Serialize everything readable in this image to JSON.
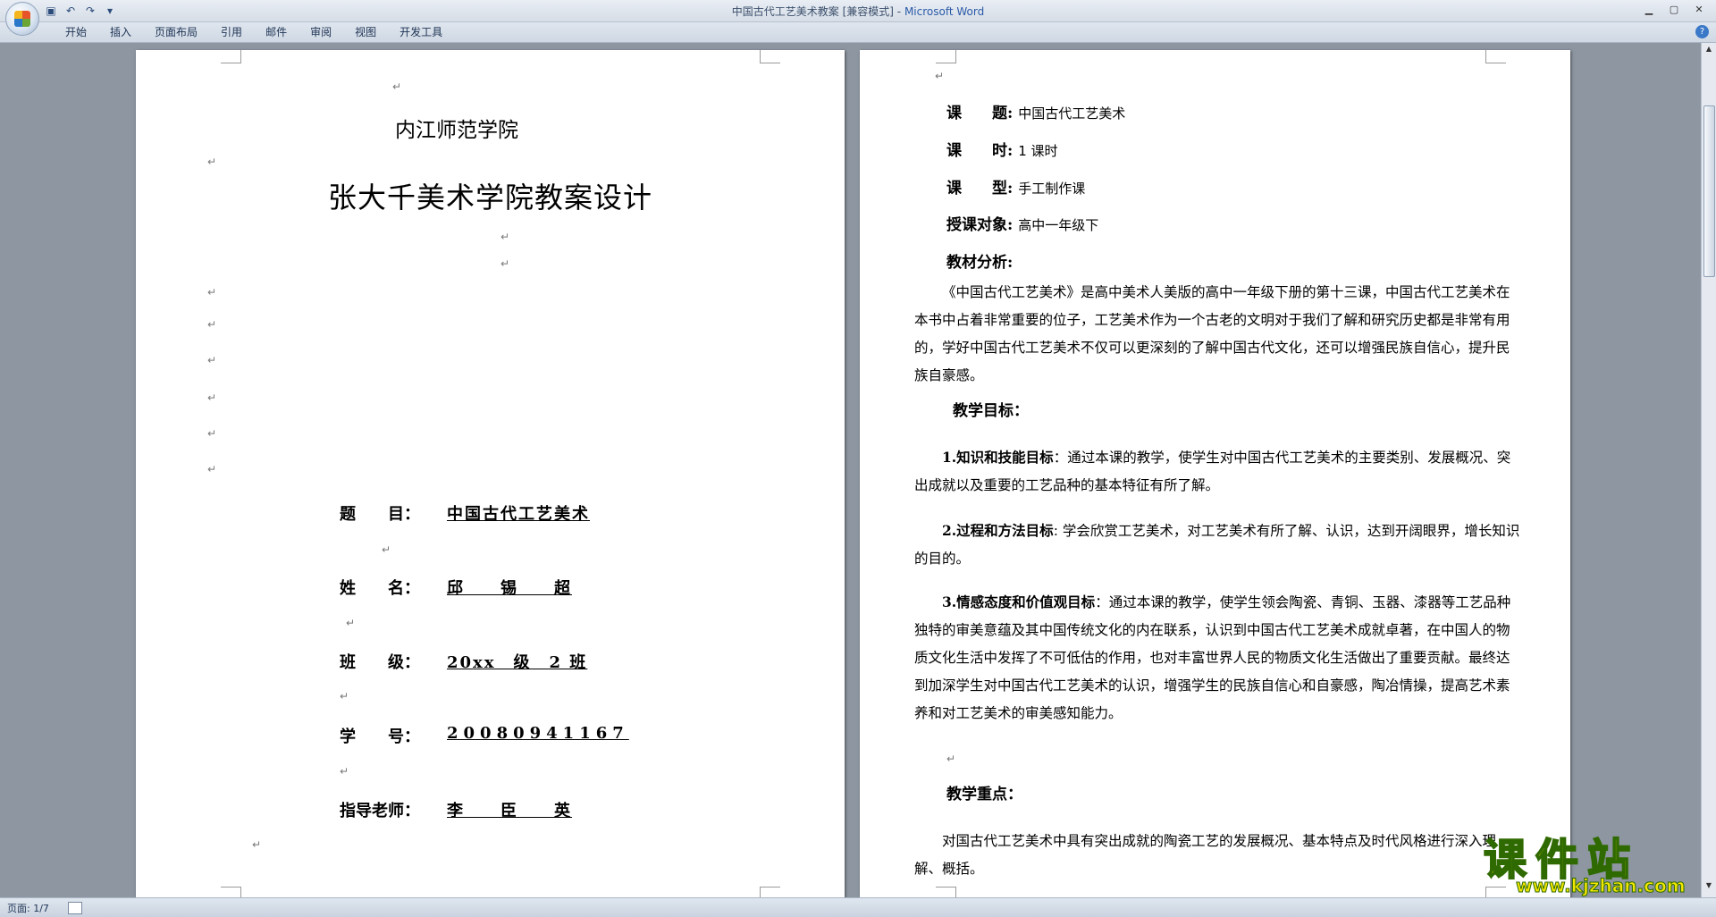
{
  "window": {
    "title": "中国古代工艺美术教案 [兼容模式]",
    "separator": " - ",
    "app": "Microsoft Word"
  },
  "qat": {
    "save": "▣",
    "undo": "↶",
    "redo": "↷",
    "more": "▾"
  },
  "ribbon": {
    "tabs": [
      "开始",
      "插入",
      "页面布局",
      "引用",
      "邮件",
      "审阅",
      "视图",
      "开发工具"
    ],
    "help": "?"
  },
  "page1": {
    "school": "内江师范学院",
    "title": "张大千美术学院教案设计",
    "fields": [
      {
        "label": "题　　目：",
        "value": "中国古代工艺美术"
      },
      {
        "label": "姓　　名：",
        "value": "邱　　锡　　超"
      },
      {
        "label": "班　　级：",
        "value": "20xx　级　2 班"
      },
      {
        "label": "学　　号：",
        "value": "20080941167"
      },
      {
        "label": "指导老师：",
        "value": "李　　臣　　英"
      }
    ]
  },
  "page2": {
    "course_title_label": "课　　题:",
    "course_title": "中国古代工艺美术",
    "hours_label": "课　　时:",
    "hours": "1 课时",
    "type_label": "课　　型:",
    "type": "手工制作课",
    "audience_label": "授课对象:",
    "audience": "高中一年级下",
    "analysis_label": "教材分析:",
    "analysis_text": "《中国古代工艺美术》是高中美术人美版的高中一年级下册的第十三课，中国古代工艺美术在本书中占着非常重要的位子，工艺美术作为一个古老的文明对于我们了解和研究历史都是非常有用的，学好中国古代工艺美术不仅可以更深刻的了解中国古代文化，还可以增强民族自信心，提升民族自豪感。",
    "goals_label": "教学目标：",
    "goal1_label": "1.知识和技能目标",
    "goal1_text": "：通过本课的教学，使学生对中国古代工艺美术的主要类别、发展概况、突出成就以及重要的工艺品种的基本特征有所了解。",
    "goal2_label": "2.过程和方法目标",
    "goal2_text": ": 学会欣赏工艺美术，对工艺美术有所了解、认识，达到开阔眼界，增长知识的目的。",
    "goal3_label": "3.情感态度和价值观目标",
    "goal3_text": "：通过本课的教学，使学生领会陶瓷、青铜、玉器、漆器等工艺品种独特的审美意蕴及其中国传统文化的内在联系，认识到中国古代工艺美术成就卓著，在中国人的物质文化生活中发挥了不可低估的作用，也对丰富世界人民的物质文化生活做出了重要贡献。最终达到加深学生对中国古代工艺美术的认识，增强学生的民族自信心和自豪感，陶冶情操，提高艺术素养和对工艺美术的审美感知能力。",
    "focus_label": "教学重点：",
    "focus_text": "对国古代工艺美术中具有突出成就的陶瓷工艺的发展概况、基本特点及时代风格进行深入理解、概括。"
  },
  "para_mark": "↵",
  "status": {
    "page": "页面: 1/7"
  },
  "watermark": {
    "main": "课件站",
    "url": "www.kjzhan.com"
  }
}
